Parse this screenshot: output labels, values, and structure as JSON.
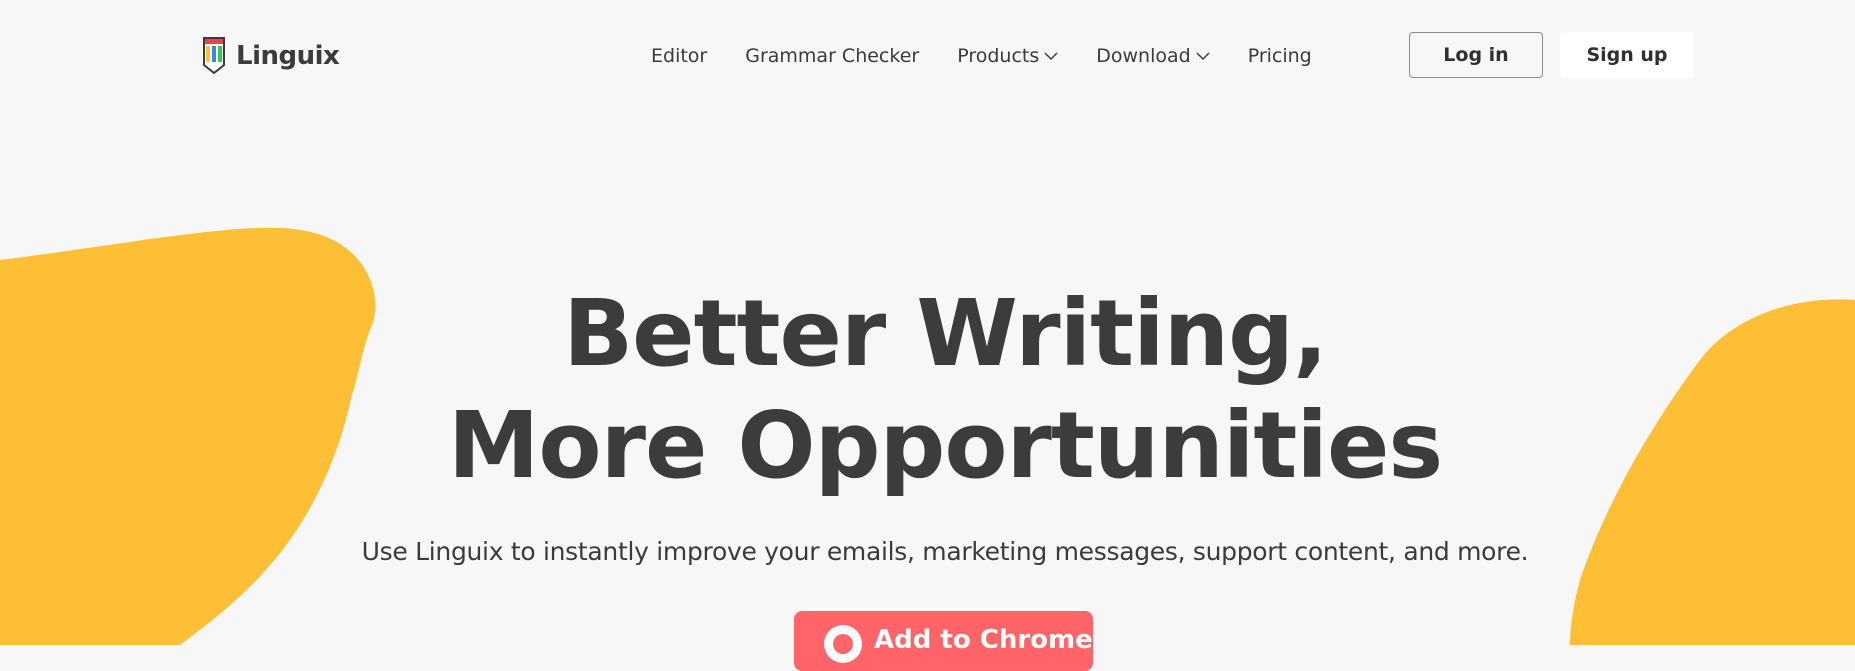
{
  "brand": {
    "name": "Linguix",
    "logo_colors": [
      "#e8414f",
      "#3b82f6",
      "#34c759",
      "#f9c22e"
    ]
  },
  "nav": {
    "items": [
      {
        "label": "Editor",
        "dropdown": false
      },
      {
        "label": "Grammar Checker",
        "dropdown": false
      },
      {
        "label": "Products",
        "dropdown": true
      },
      {
        "label": "Download",
        "dropdown": true
      },
      {
        "label": "Pricing",
        "dropdown": false
      }
    ]
  },
  "auth": {
    "login_label": "Log in",
    "signup_label": "Sign up"
  },
  "hero": {
    "title_line1": "Better Writing,",
    "title_line2": "More Opportunities",
    "subtitle": "Use Linguix to instantly improve your emails, marketing messages, support content, and more.",
    "cta_label": "Add to Chrome",
    "cta_icon": "chrome-icon"
  },
  "colors": {
    "background": "#f7f7f7",
    "blob": "#fdbf35",
    "text": "#3a3b3d",
    "cta": "#ff6469"
  }
}
